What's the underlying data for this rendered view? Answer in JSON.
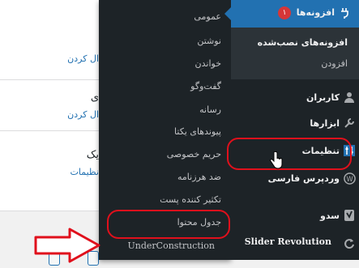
{
  "main": {
    "cards": [
      {
        "title": "",
        "link": "ال کردن"
      },
      {
        "title": "ی",
        "link": "ال کردن"
      },
      {
        "title": "یک",
        "link": "نظیمات"
      }
    ]
  },
  "flyout": {
    "items": [
      "عمومی",
      "نوشتن",
      "خواندن",
      "گفت‌وگو",
      "رسانه",
      "پیوندهای یکتا",
      "حریم خصوصی",
      "ضد هرزنامه",
      "تکثیر کننده پست",
      "جدول محتوا",
      "UnderConstruction"
    ]
  },
  "sidebar": {
    "plugins": {
      "label": "افزونه‌ها",
      "badge": "۱"
    },
    "plugin_sub": [
      "افزونه‌های نصب‌شده",
      "افزودن"
    ],
    "items": [
      {
        "label": "کاربران",
        "icon": "user-icon"
      },
      {
        "label": "ابزارها",
        "icon": "wrench-icon"
      },
      {
        "label": "تنظیمات",
        "icon": "settings-icon"
      },
      {
        "label": "وردپرس فارسی",
        "icon": "wp-icon"
      },
      {
        "label": "سدو",
        "icon": "yoast-icon"
      },
      {
        "label": "Slider Revolution",
        "icon": "refresh-icon"
      }
    ]
  },
  "colors": {
    "accent": "#2271b1",
    "highlight": "#e0101c",
    "sidebar_bg": "#1d2327"
  }
}
